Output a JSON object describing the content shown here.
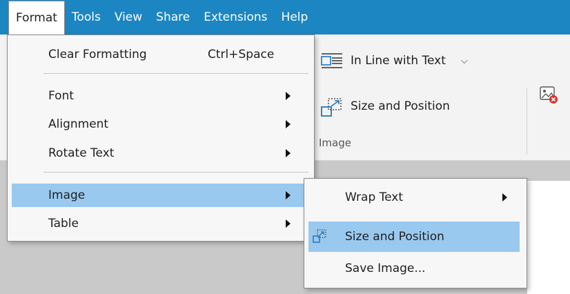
{
  "menubar": {
    "items": [
      "Format",
      "Tools",
      "View",
      "Share",
      "Extensions",
      "Help"
    ],
    "active_index": 0
  },
  "ribbon": {
    "wrap_label": "In Line with Text",
    "size_position_label": "Size and Position",
    "group_label": "Image"
  },
  "format_menu": {
    "clear_formatting": "Clear Formatting",
    "clear_formatting_shortcut": "Ctrl+Space",
    "font": "Font",
    "alignment": "Alignment",
    "rotate_text": "Rotate Text",
    "image": "Image",
    "table": "Table"
  },
  "image_submenu": {
    "wrap_text": "Wrap Text",
    "size_and_position": "Size and Position",
    "save_image": "Save Image..."
  },
  "colors": {
    "menubar_bg": "#1c86c2",
    "highlight": "#99c9ef",
    "icon_blue": "#1a78c2",
    "icon_red": "#e0312b"
  }
}
